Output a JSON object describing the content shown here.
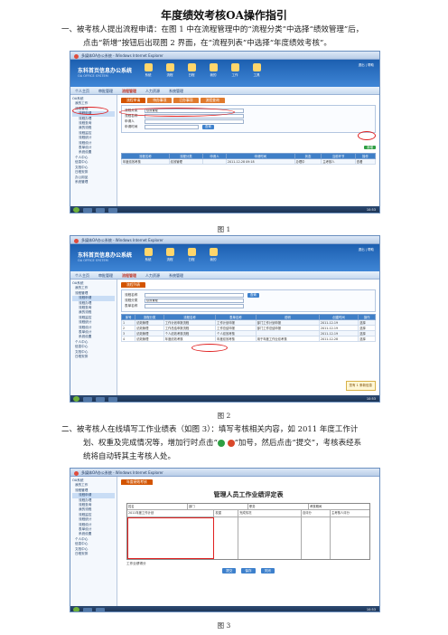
{
  "doc": {
    "title": "年度绩效考核OA操作指引",
    "step1_line1": "一、被考核人提出流程申请：在图 1 中在流程管理中的“流程分类”中选择“绩效管理”后，",
    "step1_line2": "点击“新增”按钮后出现图 2 界面，在“流程列表”中选择“年度绩效考核”。",
    "caption1": "图 1",
    "caption2": "图 2",
    "step2_line1_a": "二、被考核人在线填写工作业绩表（如图 3）：",
    "step2_line1_b": "填写考核相关内容，如 2011 年度工作计",
    "step2_line2_a": "划、权重及完成情况等，增加行时点击“",
    "step2_line2_b": "”加号，然后点击“提交”，考核表经系",
    "step2_line3": "统将自动转其主考核人处。",
    "caption3": "图 3"
  },
  "app": {
    "browser_title": "多媒体OA办公系统 - Windows Internet Explorer",
    "sys_title": "东科首页信息办公系统",
    "sys_sub": "OA OFFICE SYSTEM",
    "top_icons": [
      "系统",
      "流程",
      "日程",
      "我的",
      "工作",
      "工具"
    ],
    "right_tools": "退出 | 帮助",
    "nav": [
      "个人主页",
      "审批管理",
      "流程管理",
      "人力资源",
      "系统管理"
    ],
    "sidebar": [
      {
        "label": "OA系统",
        "level": 0
      },
      {
        "label": "我的工作",
        "level": 1
      },
      {
        "label": "流程管理",
        "level": 1
      },
      {
        "label": "流程申请",
        "level": 2
      },
      {
        "label": "流程办理",
        "level": 2
      },
      {
        "label": "流程查询",
        "level": 2
      },
      {
        "label": "我的流程",
        "level": 2
      },
      {
        "label": "流程监控",
        "level": 2
      },
      {
        "label": "流程统计",
        "level": 2
      },
      {
        "label": "流程设计",
        "level": 2
      },
      {
        "label": "表单设计",
        "level": 2
      },
      {
        "label": "系统设置",
        "level": 2
      },
      {
        "label": "个人中心",
        "level": 1
      },
      {
        "label": "信息中心",
        "level": 1
      },
      {
        "label": "文档中心",
        "level": 1
      },
      {
        "label": "日程安排",
        "level": 1
      },
      {
        "label": "办公用品",
        "level": 1
      },
      {
        "label": "系统管理",
        "level": 1
      }
    ],
    "taskbar_clock": "10:53",
    "popup": "您有 1 条新信息"
  },
  "fig1": {
    "tabs": [
      "流程申请",
      "待办事项",
      "已办事项",
      "流程查询"
    ],
    "form": [
      {
        "label": "流程分类",
        "value": "绩效管理"
      },
      {
        "label": "流程名称",
        "value": ""
      },
      {
        "label": "申请人",
        "value": ""
      },
      {
        "label": "申请时间",
        "value": ""
      }
    ],
    "search_btn": "查询",
    "add_btn": "新增",
    "columns": [
      "流程名称",
      "流程分类",
      "申请人",
      "申请时间",
      "状态",
      "当前环节",
      "操作"
    ],
    "rows": [
      [
        "年度绩效考核",
        "绩效管理",
        "",
        "2011-12-28 09:18",
        "办理中",
        "主考核人",
        "查看"
      ]
    ]
  },
  "fig2": {
    "tabs": [
      "流程列表"
    ],
    "form": [
      {
        "label": "流程名称",
        "value": ""
      },
      {
        "label": "流程分类",
        "value": "绩效管理"
      },
      {
        "label": "表单名称",
        "value": ""
      }
    ],
    "search_btn": "查询",
    "columns": [
      "序号",
      "流程分类",
      "流程名称",
      "表单名称",
      "说明",
      "创建时间",
      "操作"
    ],
    "rows": [
      [
        "1",
        "绩效管理",
        "工作计划申报流程",
        "工作计划申报",
        "部门工作计划申报",
        "2011-12-19",
        "选择"
      ],
      [
        "2",
        "绩效管理",
        "工作总结申报流程",
        "工作总结申报",
        "部门工作总结申报",
        "2011-12-19",
        "选择"
      ],
      [
        "3",
        "绩效管理",
        "个人绩效考核流程",
        "个人绩效考核",
        "",
        "2011-12-19",
        "选择"
      ],
      [
        "4",
        "绩效管理",
        "年度绩效考核",
        "年度绩效考核",
        "用于年度工作业绩考核",
        "2011-12-28",
        "选择"
      ]
    ]
  },
  "fig3": {
    "tab": "年度绩效考核",
    "form_title": "管理人员工作业绩评定表",
    "header_cells": [
      "姓名",
      "部门",
      "职务",
      "考核期间"
    ],
    "columns": [
      "2011年度工作计划",
      "权重",
      "完成情况",
      "自评分",
      "主考核人评分"
    ],
    "footer": "工作业绩得分",
    "buttons": [
      "提交",
      "保存",
      "关闭"
    ]
  }
}
